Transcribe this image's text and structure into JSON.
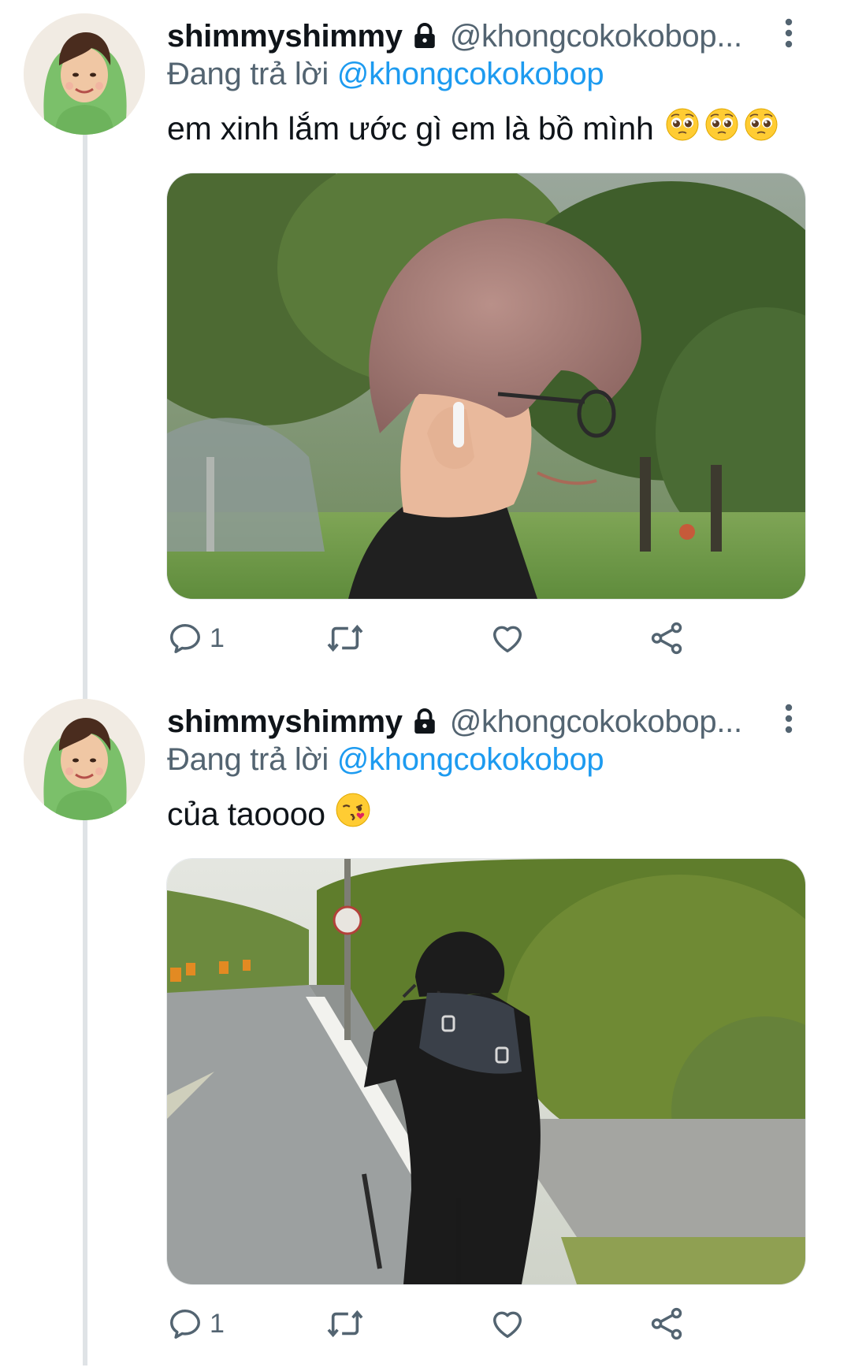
{
  "tweets": [
    {
      "display_name": "shimmyshimmy",
      "handle": "@khongcokokobop...",
      "replying_prefix": "Đang trả lời",
      "replying_to": "@khongcokokobop",
      "text": "em xinh lắm ước gì em là bồ mình",
      "emojis": [
        "pleading-face-emoji",
        "pleading-face-emoji",
        "pleading-face-emoji"
      ],
      "media_description_icon": "photo",
      "reply_count": "1"
    },
    {
      "display_name": "shimmyshimmy",
      "handle": "@khongcokokobop...",
      "replying_prefix": "Đang trả lời",
      "replying_to": "@khongcokokobop",
      "text": "của taoooo",
      "emojis": [
        "kissing-face-emoji"
      ],
      "media_description_icon": "photo",
      "reply_count": "1"
    }
  ],
  "icons": {
    "lock": "lock-icon",
    "more": "more-vertical-icon",
    "reply": "reply-icon",
    "retweet": "retweet-icon",
    "like": "heart-icon",
    "share": "share-icon"
  },
  "colors": {
    "text_primary": "#0f1419",
    "text_secondary": "#536471",
    "link": "#1d9bf0",
    "thread_line": "#dfe3e6"
  }
}
